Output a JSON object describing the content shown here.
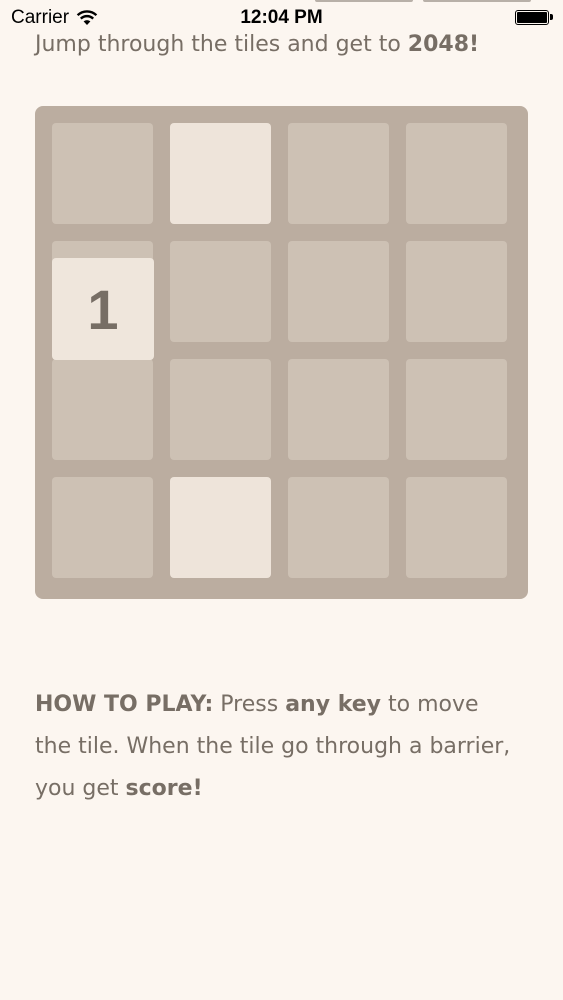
{
  "status_bar": {
    "carrier": "Carrier",
    "time": "12:04 PM",
    "icons": [
      "wifi-icon",
      "battery-icon"
    ]
  },
  "tagline": {
    "prefix": "Jump through the tiles and get to ",
    "target": "2048",
    "suffix": "!"
  },
  "board": {
    "rows": 4,
    "cols": 4,
    "barriers": [
      {
        "row": 0,
        "col": 1
      },
      {
        "row": 3,
        "col": 1
      }
    ],
    "player_tile": {
      "value": "1",
      "row": 1,
      "col": 0
    }
  },
  "how_to_play": {
    "heading": "HOW TO PLAY:",
    "text1": " Press ",
    "key": "any key",
    "text2": " to move the tile. When the tile go through a barrier, you get ",
    "score": "score!"
  },
  "colors": {
    "background": "#fcf6f0",
    "board": "#bbada0",
    "empty_cell": "#cdc1b4",
    "barrier": "#eee4da",
    "text": "#776e65"
  }
}
